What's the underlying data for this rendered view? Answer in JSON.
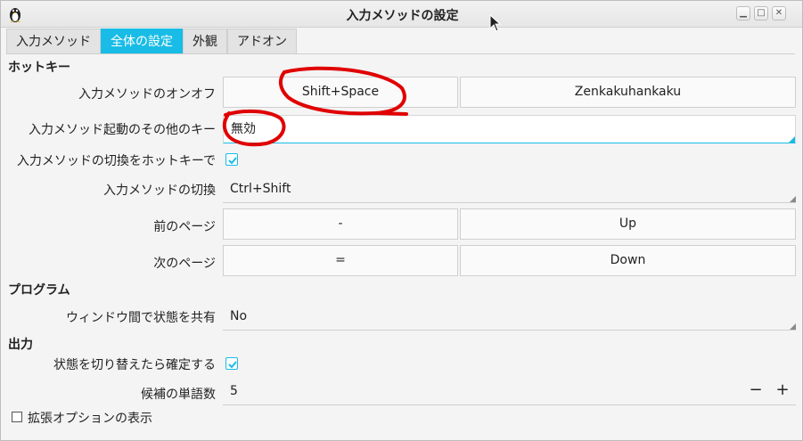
{
  "window": {
    "title": "入力メソッドの設定",
    "app_icon": "penguin-icon",
    "controls": [
      "minimize",
      "maximize",
      "close"
    ]
  },
  "tabs": [
    {
      "label": "入力メソッド",
      "active": false
    },
    {
      "label": "全体の設定",
      "active": true
    },
    {
      "label": "外観",
      "active": false
    },
    {
      "label": "アドオン",
      "active": false
    }
  ],
  "sections": {
    "hotkey": "ホットキー",
    "program": "プログラム",
    "output": "出力"
  },
  "rows": {
    "toggle": {
      "label": "入力メソッドのオンオフ",
      "key1": "Shift+Space",
      "key2": "Zenkakuhankaku"
    },
    "extra_trigger": {
      "label": "入力メソッド起動のその他のキー",
      "value": "無効"
    },
    "switch_hotkey": {
      "label": "入力メソッドの切換をホットキーで",
      "checked": true
    },
    "switch": {
      "label": "入力メソッドの切換",
      "value": "Ctrl+Shift"
    },
    "prev_page": {
      "label": "前のページ",
      "key1": "-",
      "key2": "Up"
    },
    "next_page": {
      "label": "次のページ",
      "key1": "=",
      "key2": "Down"
    },
    "share_state": {
      "label": "ウィンドウ間で状態を共有",
      "value": "No"
    },
    "commit_on_switch": {
      "label": "状態を切り替えたら確定する",
      "checked": true
    },
    "candidates": {
      "label": "候補の単語数",
      "value": "5",
      "minus": "−",
      "plus": "+"
    },
    "advanced": {
      "label": "拡張オプションの表示",
      "checked": false
    }
  },
  "colors": {
    "accent": "#19bce6",
    "annotation": "#e00000"
  }
}
